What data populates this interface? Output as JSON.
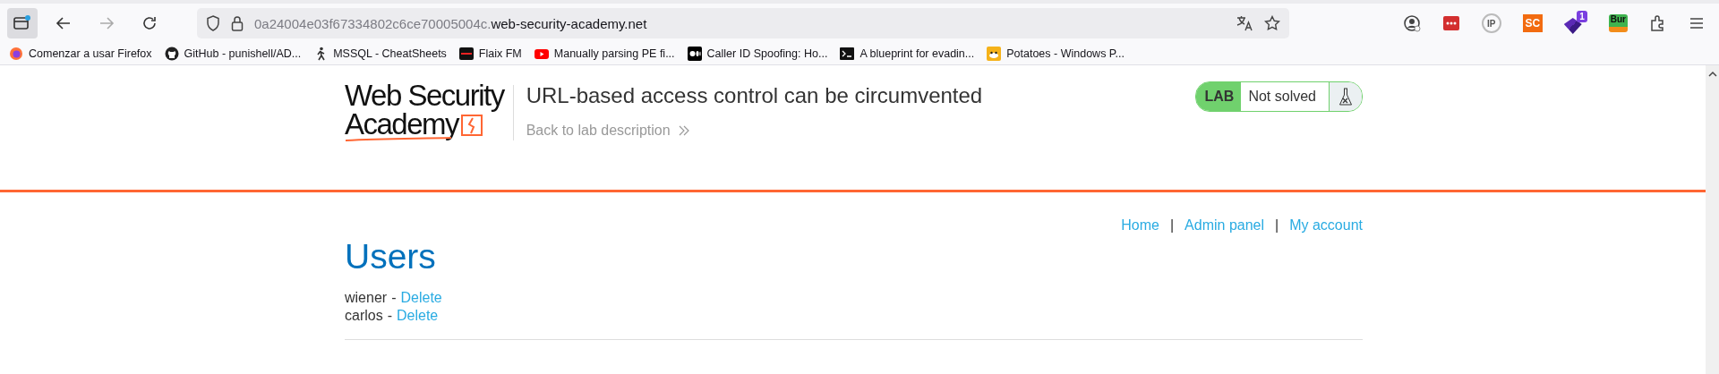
{
  "browser": {
    "url_prefix": "0a24004e03f67334802c6ce70005004c.",
    "url_domain": "web-security-academy.net",
    "extensions": [
      {
        "kind": "account"
      },
      {
        "kind": "dots"
      },
      {
        "kind": "ip",
        "label": "IP"
      },
      {
        "kind": "tag",
        "label": "SC"
      },
      {
        "kind": "badge",
        "label": "1"
      },
      {
        "kind": "tiger",
        "label": "Bur"
      },
      {
        "kind": "puzzle"
      }
    ],
    "bookmarks": [
      {
        "label": "Comenzar a usar Firefox",
        "kind": "firefox"
      },
      {
        "label": "GitHub - punishell/AD...",
        "kind": "github"
      },
      {
        "label": "MSSQL - CheatSheets",
        "kind": "walker"
      },
      {
        "label": "Flaix FM",
        "kind": "flaix"
      },
      {
        "label": "Manually parsing PE fi...",
        "kind": "youtube"
      },
      {
        "label": "Caller ID Spoofing: Ho...",
        "kind": "medium"
      },
      {
        "label": "A blueprint for evadin...",
        "kind": "terminal"
      },
      {
        "label": "Potatoes - Windows P...",
        "kind": "potato"
      }
    ]
  },
  "header": {
    "logo_line_1": "Web Security",
    "logo_line_2": "Academy",
    "lab_title": "URL-based access control can be circumvented",
    "back_link": "Back to lab description",
    "status_label": "LAB",
    "status": "Not solved",
    "solved": false
  },
  "nav": [
    {
      "label": "Home"
    },
    {
      "separator": "|",
      "label": "Admin panel"
    },
    {
      "separator": "|",
      "label": "My account"
    }
  ],
  "heading": "Users",
  "users": [
    {
      "name": "wiener",
      "separator": "-",
      "action": "Delete"
    },
    {
      "name": "carlos",
      "separator": "-",
      "action": "Delete"
    }
  ]
}
